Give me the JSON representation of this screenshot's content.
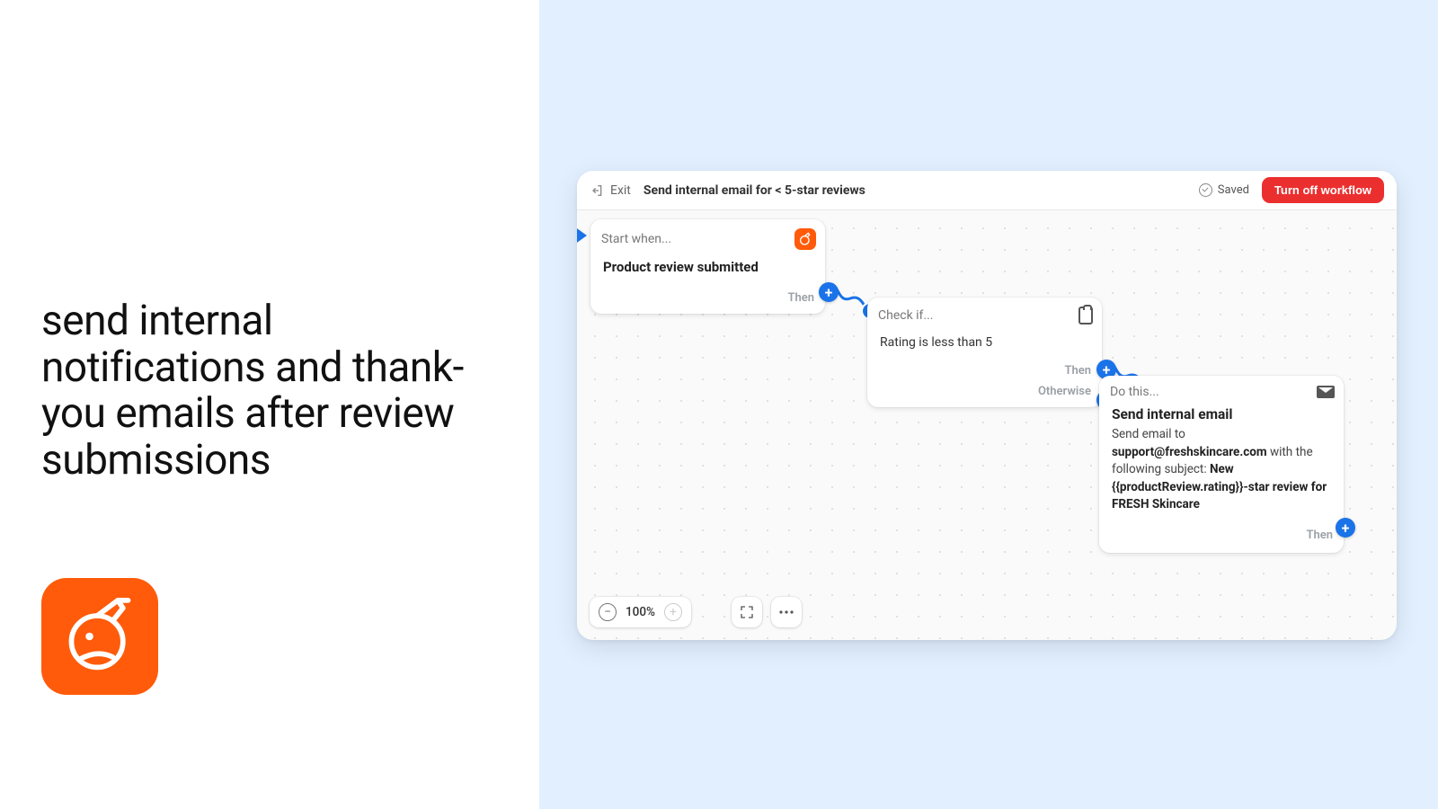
{
  "left": {
    "headline": "send internal notifications and thank-you emails after review submissions"
  },
  "topbar": {
    "exit_label": "Exit",
    "title": "Send internal email for < 5-star reviews",
    "saved_label": "Saved",
    "turn_off_label": "Turn off workflow"
  },
  "nodes": {
    "trigger": {
      "header": "Start when...",
      "body": "Product review submitted",
      "then": "Then"
    },
    "condition": {
      "header": "Check if...",
      "body": "Rating is less than 5",
      "then": "Then",
      "otherwise": "Otherwise"
    },
    "action": {
      "header": "Do this...",
      "title": "Send internal email",
      "text_prefix": "Send email to ",
      "email": "support@freshskincare.com",
      "text_mid": " with the following subject: ",
      "subject": "New {{productReview.rating}}-star review for FRESH Skincare",
      "then": "Then"
    }
  },
  "zoom": {
    "level": "100%"
  }
}
